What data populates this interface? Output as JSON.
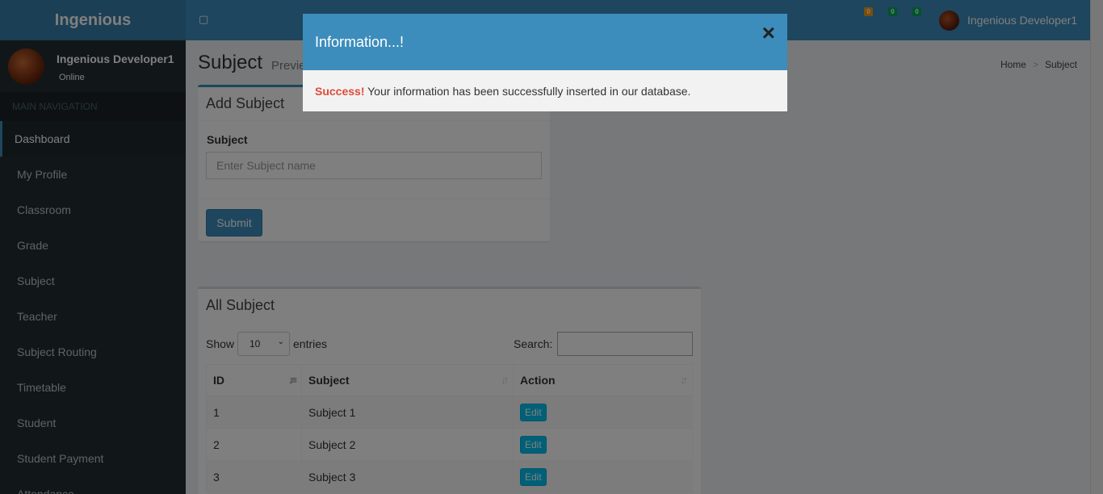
{
  "header": {
    "logo": "Ingenious",
    "toggle_icon": "hamburger-icon",
    "badges": [
      "0",
      "0",
      "0"
    ],
    "user_name": "Ingenious Developer1"
  },
  "sidebar": {
    "user_name": "Ingenious Developer1",
    "status": "Online",
    "nav_header": "MAIN NAVIGATION",
    "items": [
      {
        "label": "Dashboard"
      },
      {
        "label": "My Profile"
      },
      {
        "label": "Classroom"
      },
      {
        "label": "Grade"
      },
      {
        "label": "Subject"
      },
      {
        "label": "Teacher"
      },
      {
        "label": "Subject Routing"
      },
      {
        "label": "Timetable"
      },
      {
        "label": "Student"
      },
      {
        "label": "Student Payment"
      },
      {
        "label": "Attendance"
      }
    ]
  },
  "page": {
    "title": "Subject",
    "subtitle": "Preview",
    "breadcrumb": [
      "Home",
      "Subject"
    ]
  },
  "add_subject": {
    "title": "Add Subject",
    "label": "Subject",
    "placeholder": "Enter Subject name",
    "submit": "Submit"
  },
  "all_subject": {
    "title": "All Subject",
    "show_label": "Show",
    "page_size": "10",
    "entries_label": "entries",
    "search_label": "Search:",
    "columns": [
      "ID",
      "Subject",
      "Action"
    ],
    "rows": [
      {
        "id": "1",
        "subject": "Subject 1",
        "action": "Edit"
      },
      {
        "id": "2",
        "subject": "Subject 2",
        "action": "Edit"
      },
      {
        "id": "3",
        "subject": "Subject 3",
        "action": "Edit"
      }
    ]
  },
  "modal": {
    "title": "Information...!",
    "close": "×",
    "success_label": "Success!",
    "message": " Your information has been successfully inserted in our database."
  },
  "colors": {
    "primary": "#3c8dbc",
    "sidebar": "#222d32",
    "edit_button": "#00c0ef",
    "success_text": "#dd4b39"
  }
}
